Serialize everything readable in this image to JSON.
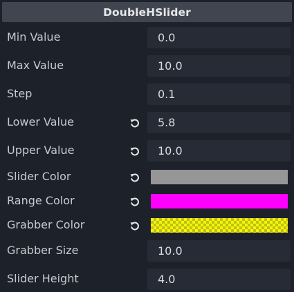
{
  "inspector": {
    "title": "DoubleHSlider",
    "properties": {
      "min_value": {
        "label": "Min Value",
        "value": "0.0"
      },
      "max_value": {
        "label": "Max Value",
        "value": "10.0"
      },
      "step": {
        "label": "Step",
        "value": "0.1"
      },
      "lower_value": {
        "label": "Lower Value",
        "value": "5.8"
      },
      "upper_value": {
        "label": "Upper Value",
        "value": "10.0"
      },
      "slider_color": {
        "label": "Slider Color",
        "color": "#969696"
      },
      "range_color": {
        "label": "Range Color",
        "color": "#ff00ff"
      },
      "grabber_color": {
        "label": "Grabber Color",
        "color": "#ffff00",
        "alpha": "semi-transparent"
      },
      "grabber_size": {
        "label": "Grabber Size",
        "value": "10.0"
      },
      "slider_height": {
        "label": "Slider Height",
        "value": "4.0"
      }
    },
    "icons": {
      "revert": "revert-icon"
    },
    "colors": {
      "background": "#1d212a",
      "header": "#40454f",
      "field": "#262b35"
    }
  }
}
